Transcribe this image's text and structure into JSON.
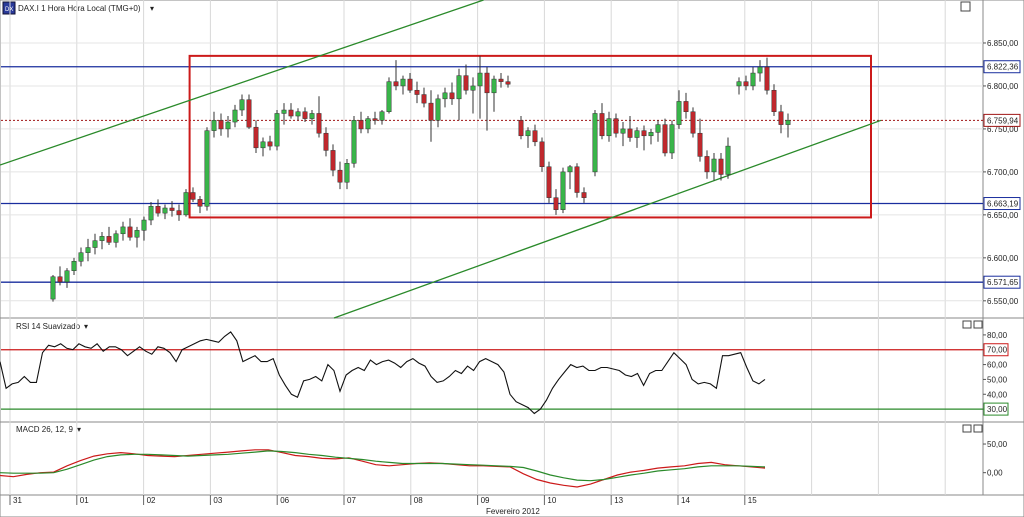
{
  "header": {
    "title": "DAX.I 1 Hora Hora Local (TMG+0)"
  },
  "chart_data": [
    {
      "type": "candlestick",
      "title": "DAX.I 1 Hora Hora Local (TMG+0)",
      "ylim": [
        6530,
        6900
      ],
      "y_ticks": [
        "6.850,00",
        "6.800,00",
        "6.750,00",
        "6.700,00",
        "6.650,00",
        "6.600,00",
        "6.550,00"
      ],
      "y_tick_values": [
        6850,
        6800,
        6750,
        6700,
        6650,
        6600,
        6550
      ],
      "price_markers": [
        {
          "label": "6.822,36",
          "value": 6822.36,
          "color": "#1a2e9e"
        },
        {
          "label": "6.759,94",
          "value": 6759.94,
          "color": "#a01515"
        },
        {
          "label": "6.663,19",
          "value": 6663.19,
          "color": "#1a2e9e"
        },
        {
          "label": "6.571,65",
          "value": 6571.65,
          "color": "#1a2e9e"
        }
      ],
      "horizontal_lines": [
        {
          "value": 6822.36,
          "color": "#1a2e9e",
          "style": "solid"
        },
        {
          "value": 6759.94,
          "color": "#a01515",
          "style": "dotted"
        },
        {
          "value": 6663.19,
          "color": "#1a2e9e",
          "style": "solid"
        },
        {
          "value": 6571.65,
          "color": "#1a2e9e",
          "style": "solid"
        }
      ],
      "rectangle": {
        "from": "02",
        "to_after": "15",
        "y_top": 6835,
        "y_bottom": 6647,
        "color": "#cc1a1a"
      },
      "trendlines": [
        {
          "color": "#2a8a2a",
          "from": {
            "x": "31",
            "y": 6708
          },
          "to": {
            "x": "09",
            "y": 6900
          }
        },
        {
          "color": "#2a8a2a",
          "from": {
            "x": "07",
            "y": 6530
          },
          "to": {
            "x": "after-15",
            "y": 6760
          }
        }
      ],
      "candles": [
        [
          6552,
          6580,
          6549,
          6578
        ],
        [
          6578,
          6590,
          6568,
          6572
        ],
        [
          6572,
          6588,
          6565,
          6585
        ],
        [
          6585,
          6600,
          6580,
          6596
        ],
        [
          6596,
          6612,
          6590,
          6606
        ],
        [
          6606,
          6622,
          6596,
          6612
        ],
        [
          6612,
          6628,
          6604,
          6620
        ],
        [
          6620,
          6630,
          6610,
          6625
        ],
        [
          6625,
          6636,
          6615,
          6618
        ],
        [
          6618,
          6632,
          6612,
          6628
        ],
        [
          6628,
          6642,
          6620,
          6636
        ],
        [
          6636,
          6646,
          6620,
          6624
        ],
        [
          6624,
          6636,
          6612,
          6632
        ],
        [
          6632,
          6648,
          6620,
          6644
        ],
        [
          6644,
          6665,
          6638,
          6660
        ],
        [
          6660,
          6668,
          6648,
          6652
        ],
        [
          6652,
          6662,
          6645,
          6658
        ],
        [
          6658,
          6666,
          6648,
          6655
        ],
        [
          6655,
          6662,
          6643,
          6650
        ],
        [
          6650,
          6680,
          6648,
          6676
        ],
        [
          6676,
          6682,
          6665,
          6668
        ],
        [
          6668,
          6672,
          6652,
          6660
        ],
        [
          6660,
          6752,
          6655,
          6748
        ],
        [
          6748,
          6770,
          6740,
          6760
        ],
        [
          6760,
          6768,
          6742,
          6750
        ],
        [
          6750,
          6765,
          6740,
          6758
        ],
        [
          6758,
          6778,
          6752,
          6772
        ],
        [
          6772,
          6790,
          6765,
          6784
        ],
        [
          6784,
          6790,
          6750,
          6752
        ],
        [
          6752,
          6760,
          6722,
          6728
        ],
        [
          6728,
          6740,
          6718,
          6735
        ],
        [
          6735,
          6742,
          6725,
          6730
        ],
        [
          6730,
          6772,
          6725,
          6768
        ],
        [
          6768,
          6780,
          6755,
          6772
        ],
        [
          6772,
          6780,
          6762,
          6765
        ],
        [
          6765,
          6774,
          6760,
          6770
        ],
        [
          6770,
          6775,
          6758,
          6762
        ],
        [
          6762,
          6772,
          6755,
          6768
        ],
        [
          6768,
          6788,
          6740,
          6745
        ],
        [
          6745,
          6752,
          6718,
          6725
        ],
        [
          6725,
          6732,
          6695,
          6702
        ],
        [
          6702,
          6712,
          6680,
          6688
        ],
        [
          6688,
          6715,
          6680,
          6710
        ],
        [
          6710,
          6765,
          6705,
          6760
        ],
        [
          6760,
          6770,
          6745,
          6750
        ],
        [
          6750,
          6765,
          6745,
          6762
        ],
        [
          6762,
          6770,
          6755,
          6760
        ],
        [
          6760,
          6772,
          6755,
          6770
        ],
        [
          6770,
          6810,
          6768,
          6805
        ],
        [
          6805,
          6830,
          6795,
          6800
        ],
        [
          6800,
          6812,
          6790,
          6808
        ],
        [
          6808,
          6815,
          6792,
          6795
        ],
        [
          6795,
          6805,
          6780,
          6790
        ],
        [
          6790,
          6798,
          6775,
          6780
        ],
        [
          6780,
          6795,
          6735,
          6760
        ],
        [
          6760,
          6790,
          6752,
          6785
        ],
        [
          6785,
          6798,
          6775,
          6792
        ],
        [
          6792,
          6804,
          6778,
          6785
        ],
        [
          6785,
          6820,
          6760,
          6812
        ],
        [
          6812,
          6825,
          6790,
          6795
        ],
        [
          6795,
          6810,
          6768,
          6800
        ],
        [
          6800,
          6835,
          6762,
          6815
        ],
        [
          6815,
          6822,
          6748,
          6792
        ],
        [
          6792,
          6812,
          6770,
          6808
        ],
        [
          6808,
          6815,
          6798,
          6805
        ],
        [
          6805,
          6812,
          6798,
          6802
        ],
        [
          6760,
          6765,
          6738,
          6742
        ],
        [
          6742,
          6752,
          6728,
          6748
        ],
        [
          6748,
          6755,
          6730,
          6735
        ],
        [
          6735,
          6740,
          6700,
          6706
        ],
        [
          6706,
          6712,
          6664,
          6670
        ],
        [
          6670,
          6680,
          6650,
          6656
        ],
        [
          6656,
          6705,
          6652,
          6700
        ],
        [
          6700,
          6708,
          6680,
          6706
        ],
        [
          6706,
          6710,
          6670,
          6676
        ],
        [
          6676,
          6682,
          6664,
          6670
        ],
        [
          6700,
          6772,
          6695,
          6768
        ],
        [
          6768,
          6780,
          6738,
          6742
        ],
        [
          6742,
          6770,
          6735,
          6762
        ],
        [
          6762,
          6768,
          6740,
          6745
        ],
        [
          6745,
          6758,
          6730,
          6750
        ],
        [
          6750,
          6765,
          6735,
          6740
        ],
        [
          6740,
          6752,
          6728,
          6748
        ],
        [
          6748,
          6754,
          6725,
          6742
        ],
        [
          6742,
          6750,
          6732,
          6746
        ],
        [
          6746,
          6760,
          6735,
          6755
        ],
        [
          6755,
          6762,
          6718,
          6722
        ],
        [
          6722,
          6760,
          6715,
          6755
        ],
        [
          6755,
          6795,
          6750,
          6782
        ],
        [
          6782,
          6792,
          6762,
          6770
        ],
        [
          6770,
          6775,
          6740,
          6745
        ],
        [
          6745,
          6762,
          6712,
          6718
        ],
        [
          6718,
          6725,
          6692,
          6700
        ],
        [
          6700,
          6722,
          6690,
          6715
        ],
        [
          6715,
          6722,
          6690,
          6697
        ],
        [
          6697,
          6740,
          6692,
          6730
        ],
        [
          6800,
          6810,
          6790,
          6805
        ],
        [
          6805,
          6812,
          6795,
          6800
        ],
        [
          6800,
          6822,
          6795,
          6815
        ],
        [
          6815,
          6830,
          6805,
          6822
        ],
        [
          6822,
          6833,
          6790,
          6795
        ],
        [
          6795,
          6802,
          6765,
          6770
        ],
        [
          6770,
          6778,
          6745,
          6755
        ],
        [
          6755,
          6768,
          6740,
          6760
        ]
      ],
      "x_ticks": [
        "31",
        "01",
        "02",
        "03",
        "06",
        "07",
        "08",
        "09",
        "10",
        "13",
        "14",
        "15"
      ],
      "x_axis_label": "Fevereiro 2012"
    },
    {
      "type": "line",
      "title": "RSI 14 Suavizado",
      "ylim": [
        24,
        86
      ],
      "y_ticks": [
        "80,00",
        "70,00",
        "60,00",
        "50,00",
        "40,00",
        "30,00"
      ],
      "y_tick_values": [
        80,
        70,
        60,
        50,
        40,
        30
      ],
      "levels": [
        {
          "label": "70,00",
          "value": 70,
          "color": "#cc1a1a"
        },
        {
          "label": "30,00",
          "value": 30,
          "color": "#2a8a2a"
        }
      ],
      "series": [
        {
          "color": "#111111",
          "values": [
            62,
            44,
            47,
            48,
            52,
            48,
            48,
            68,
            73,
            72,
            74,
            71,
            70,
            74,
            72,
            71,
            74,
            69,
            72,
            72,
            70,
            66,
            69,
            72,
            69,
            67,
            72,
            71,
            68,
            62,
            70,
            72,
            74,
            76,
            77,
            76,
            75,
            79,
            82,
            76,
            62,
            64,
            66,
            62,
            62,
            64,
            53,
            46,
            40,
            38,
            49,
            50,
            52,
            49,
            60,
            56,
            42,
            53,
            56,
            58,
            56,
            63,
            60,
            62,
            63,
            61,
            58,
            62,
            64,
            61,
            59,
            52,
            48,
            49,
            52,
            56,
            54,
            59,
            56,
            62,
            64,
            62,
            60,
            55,
            40,
            35,
            33,
            31,
            27,
            30,
            36,
            44,
            50,
            55,
            60,
            58,
            59,
            56,
            56,
            58,
            58,
            57,
            56,
            53,
            52,
            54,
            46,
            54,
            56,
            56,
            62,
            68,
            64,
            60,
            50,
            47,
            48,
            47,
            44,
            66,
            66,
            67,
            68,
            58,
            49,
            47,
            50
          ]
        }
      ]
    },
    {
      "type": "line",
      "title": "MACD 26, 12, 9",
      "ylim": [
        -32,
        78
      ],
      "y_ticks": [
        "50,00",
        "0,00"
      ],
      "y_tick_values": [
        50,
        0
      ],
      "series": [
        {
          "color": "#cc1a1a",
          "values": [
            -5,
            -7,
            -3,
            0,
            1,
            12,
            21,
            29,
            33,
            35,
            33,
            30,
            29,
            28,
            30,
            32,
            34,
            36,
            38,
            40,
            40,
            35,
            30,
            28,
            25,
            24,
            26,
            20,
            14,
            12,
            14,
            16,
            17,
            16,
            14,
            12,
            12,
            11,
            10,
            -2,
            -12,
            -18,
            -22,
            -25,
            -20,
            -12,
            -4,
            1,
            4,
            8,
            10,
            12,
            16,
            18,
            14,
            12,
            10,
            8
          ]
        },
        {
          "color": "#2a8a2a",
          "values": [
            0,
            -1,
            -1,
            -1,
            0,
            6,
            14,
            22,
            28,
            31,
            32,
            32,
            31,
            30,
            29,
            30,
            31,
            32,
            34,
            36,
            38,
            37,
            35,
            32,
            30,
            27,
            25,
            23,
            20,
            18,
            16,
            16,
            16,
            16,
            15,
            14,
            13,
            12,
            11,
            9,
            3,
            -4,
            -9,
            -13,
            -14,
            -12,
            -8,
            -4,
            -1,
            3,
            5,
            7,
            10,
            12,
            12,
            12,
            11,
            10
          ]
        }
      ]
    }
  ]
}
